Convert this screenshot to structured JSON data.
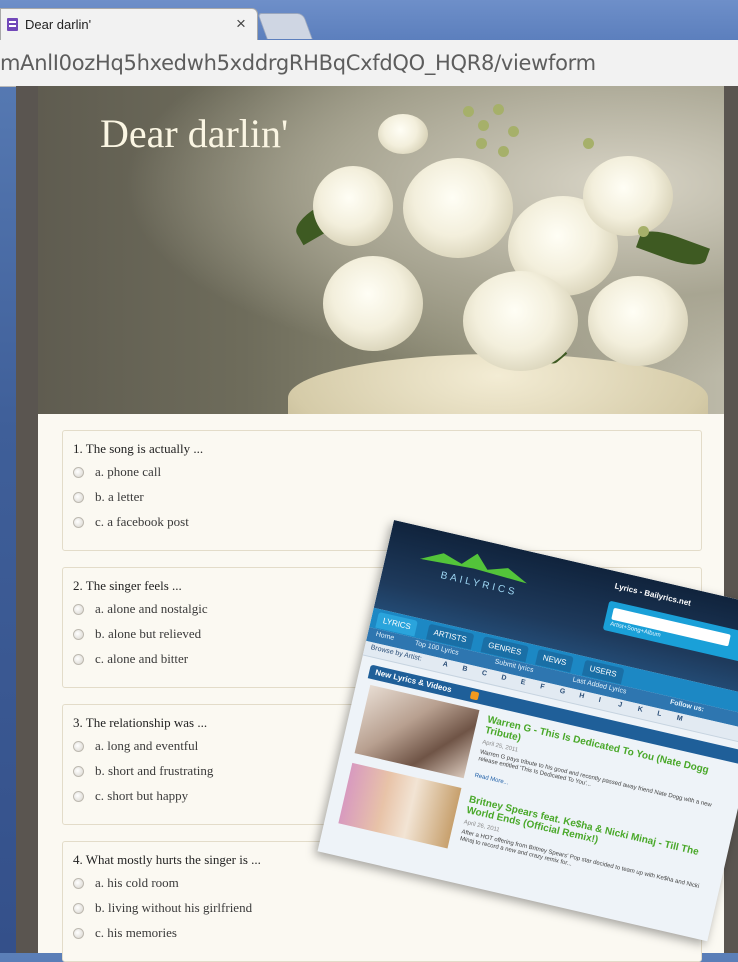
{
  "browser": {
    "tab_title": "Dear darlin'",
    "tab_close": "×",
    "url": "mAnlI0ozHq5hxedwh5xddrgRHBqCxfdQO_HQR8/viewform"
  },
  "form": {
    "title": "Dear darlin'",
    "questions": [
      {
        "text": "1. The song is actually ...",
        "options": [
          "a. phone call",
          "b. a letter",
          "c. a facebook post"
        ]
      },
      {
        "text": "2. The singer feels ...",
        "options": [
          "a. alone and nostalgic",
          "b. alone but relieved",
          "c. alone and bitter"
        ]
      },
      {
        "text": "3. The relationship was ...",
        "options": [
          "a. long and eventful",
          "b. short and frustrating",
          "c. short but happy"
        ]
      },
      {
        "text": "4. What mostly hurts the singer is ...",
        "options": [
          "a. his cold room",
          "b. living without his girlfriend",
          "c. his memories"
        ]
      }
    ]
  },
  "overlay": {
    "logo": "BAILYRICS",
    "site_name": "Lyrics - Bailyrics.net",
    "search_hint": "Artist+Song+Album",
    "nav_tabs": [
      "LYRICS",
      "ARTISTS",
      "GENRES",
      "NEWS",
      "USERS"
    ],
    "subnav": [
      "Home",
      "Top 100 Lyrics",
      "Submit lyrics",
      "Last Added Lyrics",
      "Follow us:"
    ],
    "browse_label": "Browse by Artist:",
    "letters": [
      "A",
      "B",
      "C",
      "D",
      "E",
      "F",
      "G",
      "H",
      "I",
      "J",
      "K",
      "L",
      "M"
    ],
    "section_title": "New Lyrics & Videos",
    "entries": [
      {
        "title": "Warren G - This Is Dedicated To You (Nate Dogg Tribute)",
        "date": "April 25, 2011",
        "desc": "Warren G pays tribute to his good and recently passed away friend Nate Dogg with a new release entitled 'This Is Dedicated To You'...",
        "more": "Read More..."
      },
      {
        "title": "Britney Spears feat. Ke$ha & Nicki Minaj - Till The World Ends (Official Remix!)",
        "date": "April 26, 2011",
        "desc": "After a HOT offering from Britney Spears' Pop star decided to team up with Ke$ha and Nicki Minaj to record a new and crazy remix for..."
      }
    ]
  }
}
